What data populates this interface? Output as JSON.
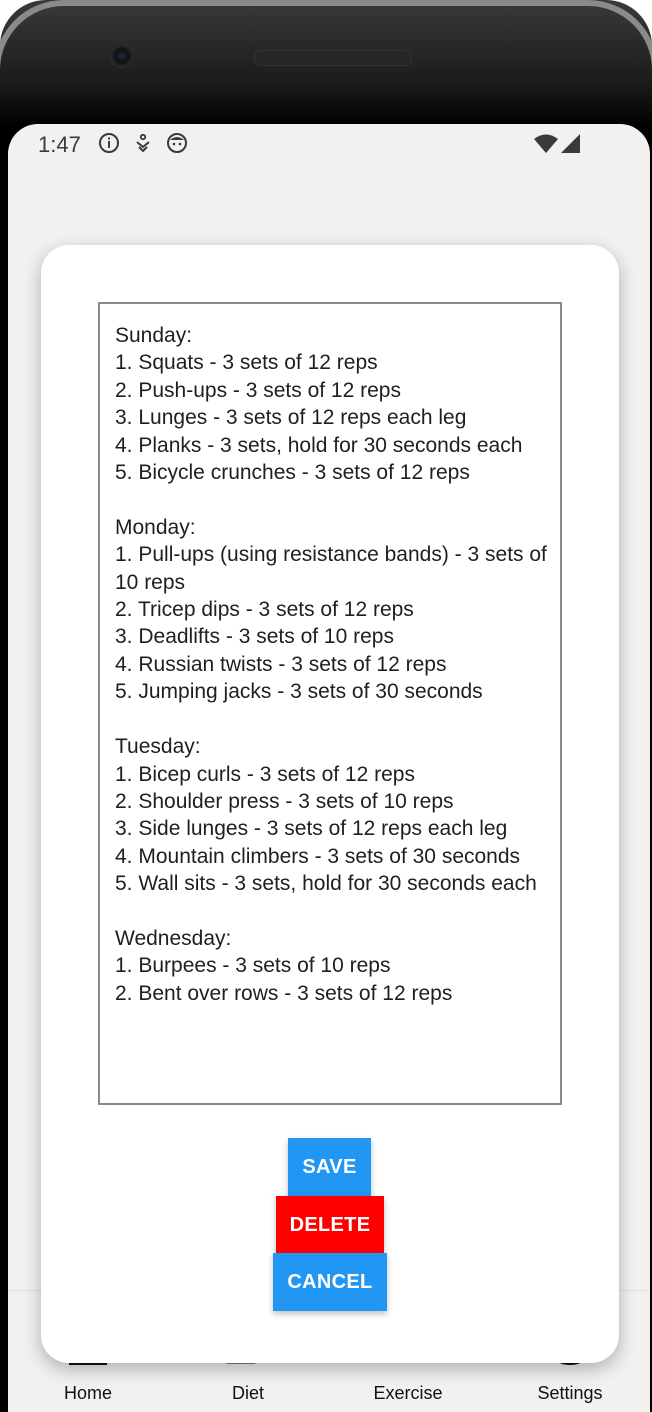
{
  "status_bar": {
    "time": "1:47",
    "left_icons": [
      "info-icon",
      "download-icon",
      "face-icon"
    ],
    "right_icons": [
      "wifi-icon",
      "signal-icon"
    ]
  },
  "dialog": {
    "routine_text": "Sunday:\n1. Squats - 3 sets of 12 reps\n2. Push-ups - 3 sets of 12 reps\n3. Lunges - 3 sets of 12 reps each leg\n4. Planks - 3 sets, hold for 30 seconds each\n5. Bicycle crunches - 3 sets of 12 reps\n\nMonday:\n1. Pull-ups (using resistance bands) - 3 sets of 10 reps\n2. Tricep dips - 3 sets of 12 reps\n3. Deadlifts - 3 sets of 10 reps\n4. Russian twists - 3 sets of 12 reps\n5. Jumping jacks - 3 sets of 30 seconds\n\nTuesday:\n1. Bicep curls - 3 sets of 12 reps\n2. Shoulder press - 3 sets of 10 reps\n3. Side lunges - 3 sets of 12 reps each leg\n4. Mountain climbers - 3 sets of 30 seconds\n5. Wall sits - 3 sets, hold for 30 seconds each\n\nWednesday:\n1. Burpees - 3 sets of 10 reps\n2. Bent over rows - 3 sets of 12 reps",
    "save_label": "SAVE",
    "delete_label": "DELETE",
    "cancel_label": "CANCEL"
  },
  "bottom_nav": {
    "items": [
      {
        "label": "Home",
        "icon": "home-icon"
      },
      {
        "label": "Diet",
        "icon": "diet-icon"
      },
      {
        "label": "Exercise",
        "icon": "exercise-icon"
      },
      {
        "label": "Settings",
        "icon": "gear-icon"
      }
    ]
  },
  "colors": {
    "primary_button": "#2196f3",
    "delete_button": "#ff0000",
    "screen_background": "#f2f1ef"
  }
}
